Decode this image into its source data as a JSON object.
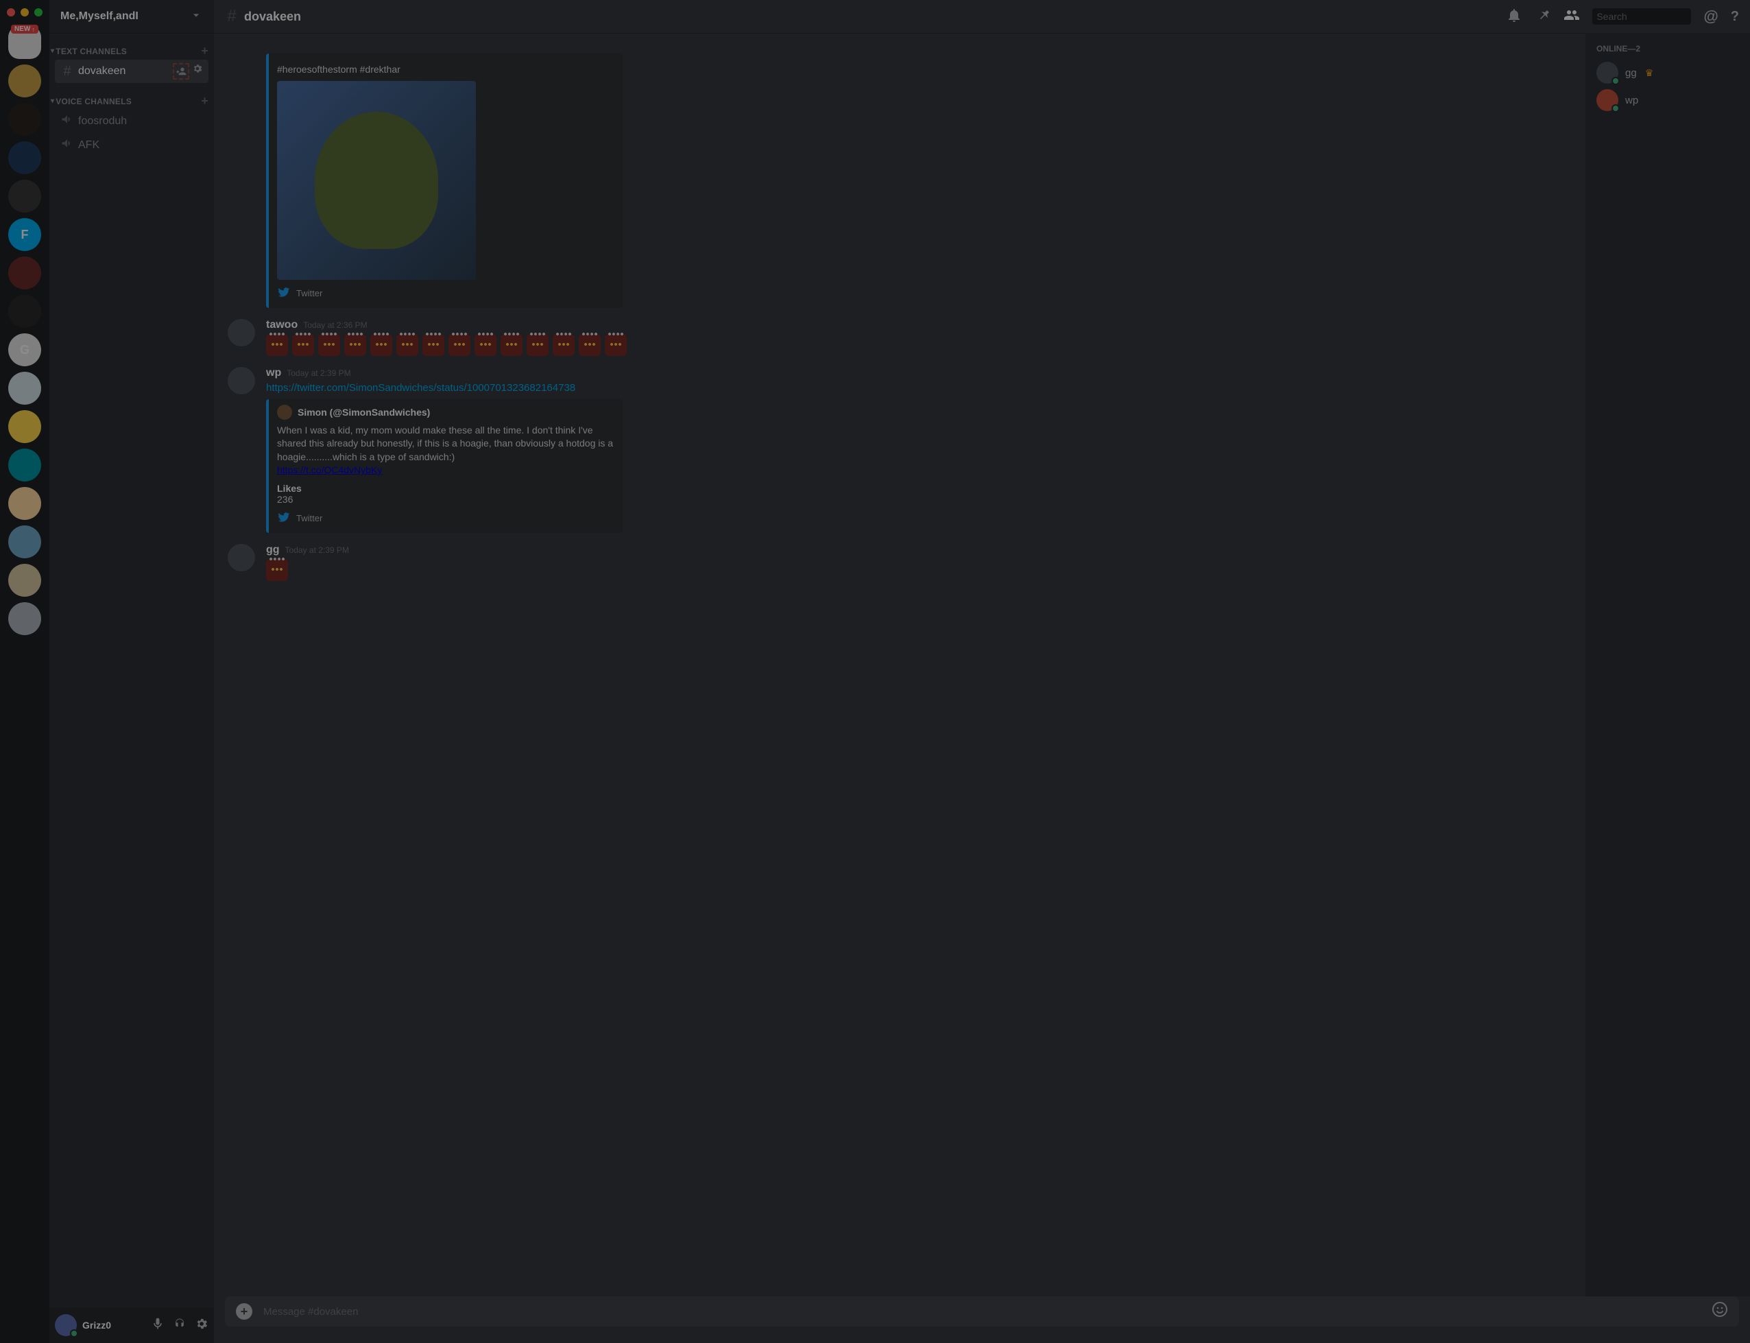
{
  "window": {
    "new_badge": "NEW"
  },
  "servers": [
    {
      "bg": "#e8e8e8",
      "squircle": true
    },
    {
      "bg": "#c9a14a"
    },
    {
      "bg": "#2a2620"
    },
    {
      "bg": "#1f3b5b",
      "label": ""
    },
    {
      "bg": "#3a3a3a",
      "label": ""
    },
    {
      "bg": "#00b0f4",
      "label": "F"
    },
    {
      "bg": "#6b2d2d"
    },
    {
      "bg": "#2b2b2b"
    },
    {
      "bg": "#e8e8e8",
      "label": "G"
    },
    {
      "bg": "#d8e4ea"
    },
    {
      "bg": "#ffd84d"
    },
    {
      "bg": "#0097a7"
    },
    {
      "bg": "#ffd9a0"
    },
    {
      "bg": "#6fa8c7"
    },
    {
      "bg": "#d9c9a3"
    },
    {
      "bg": "#b0b7bd"
    }
  ],
  "sidebar": {
    "server_name": "Me,Myself,andI",
    "categories": [
      {
        "name": "TEXT CHANNELS",
        "type": "text",
        "channels": [
          {
            "name": "dovakeen",
            "selected": true
          }
        ]
      },
      {
        "name": "VOICE CHANNELS",
        "type": "voice",
        "channels": [
          {
            "name": "foosroduh"
          },
          {
            "name": "AFK"
          }
        ]
      }
    ]
  },
  "user_panel": {
    "name": "Grizz0"
  },
  "chat": {
    "channel": "dovakeen",
    "search_placeholder": "Search",
    "compose_placeholder": "Message #dovakeen"
  },
  "messages": [
    {
      "kind": "embed-only",
      "embed": {
        "text_top": "#heroesofthestorm #drekthar",
        "footer": "Twitter"
      }
    },
    {
      "author": "tawoo",
      "time": "Today at 2:36 PM",
      "kind": "emoji",
      "emoji_count": 14
    },
    {
      "author": "wp",
      "time": "Today at 2:39 PM",
      "kind": "link-embed",
      "link": "https://twitter.com/SimonSandwiches/status/1000701323682164738",
      "embed": {
        "author": "Simon (@SimonSandwiches)",
        "desc": "When I was a kid, my mom would make these all the time. I don't think I've shared this already but honestly, if this is a hoagie, than obviously a hotdog is a hoagie..........which is a type of sandwich:)",
        "short_link": "https://t.co/QC4dvNybKy",
        "field_title": "Likes",
        "field_value": "236",
        "footer": "Twitter"
      }
    },
    {
      "author": "gg",
      "time": "Today at 2:39 PM",
      "kind": "emoji",
      "emoji_count": 1
    }
  ],
  "members": {
    "heading": "ONLINE—2",
    "list": [
      {
        "name": "gg",
        "owner": true,
        "avatar_bg": "#4f545c"
      },
      {
        "name": "wp",
        "owner": false,
        "avatar_bg": "#c14f3d"
      }
    ]
  }
}
